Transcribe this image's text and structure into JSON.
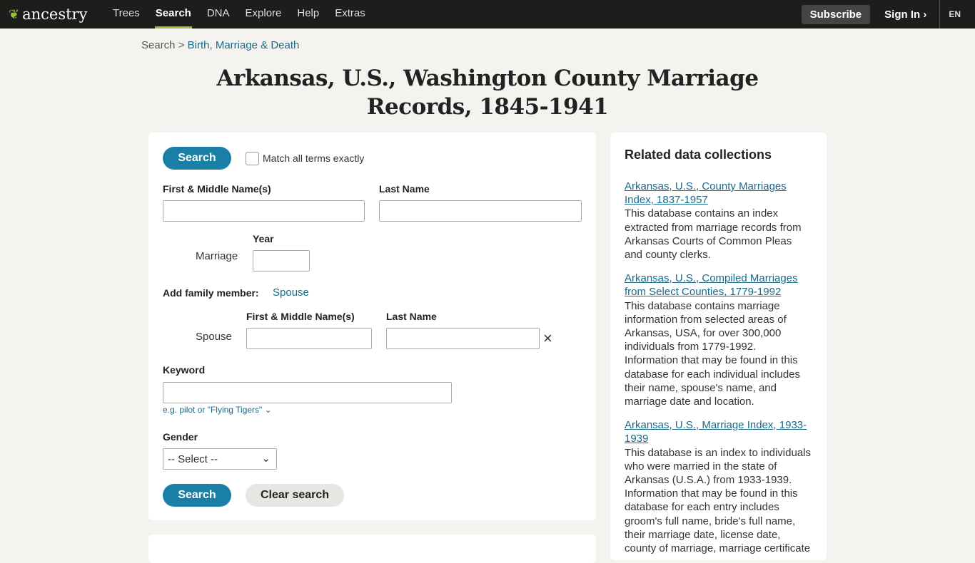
{
  "nav": {
    "logo": "ancestry",
    "items": [
      "Trees",
      "Search",
      "DNA",
      "Explore",
      "Help",
      "Extras"
    ],
    "active": "Search",
    "subscribe": "Subscribe",
    "signin": "Sign In",
    "lang": "EN"
  },
  "breadcrumb": {
    "root": "Search",
    "sep": ">",
    "current": "Birth, Marriage & Death"
  },
  "title": "Arkansas, U.S., Washington County Marriage Records, 1845-1941",
  "form": {
    "search": "Search",
    "match_exact": "Match all terms exactly",
    "first_name": "First & Middle Name(s)",
    "last_name": "Last Name",
    "year": "Year",
    "marriage": "Marriage",
    "add_family": "Add family member:",
    "spouse_link": "Spouse",
    "spouse_first": "First & Middle Name(s)",
    "spouse_last": "Last Name",
    "spouse": "Spouse",
    "keyword": "Keyword",
    "keyword_hint": "e.g. pilot or \"Flying Tigers\"",
    "gender": "Gender",
    "gender_value": "-- Select --",
    "clear": "Clear search"
  },
  "related": {
    "title": "Related data collections",
    "items": [
      {
        "link": "Arkansas, U.S., County Marriages Index, 1837-1957",
        "desc": "This database contains an index extracted from marriage records from Arkansas Courts of Common Pleas and county clerks."
      },
      {
        "link": "Arkansas, U.S., Compiled Marriages from Select Counties, 1779-1992",
        "desc": "This database contains marriage information from selected areas of Arkansas, USA, for over 300,000 individuals from 1779-1992. Information that may be found in this database for each individual includes their name, spouse's name, and marriage date and location."
      },
      {
        "link": "Arkansas, U.S., Marriage Index, 1933-1939",
        "desc": "This database is an index to individuals who were married in the state of Arkansas (U.S.A.) from 1933-1939. Information that may be found in this database for each entry includes groom's full name, bride's full name, their marriage date, license date, county of marriage, marriage certificate"
      }
    ]
  }
}
